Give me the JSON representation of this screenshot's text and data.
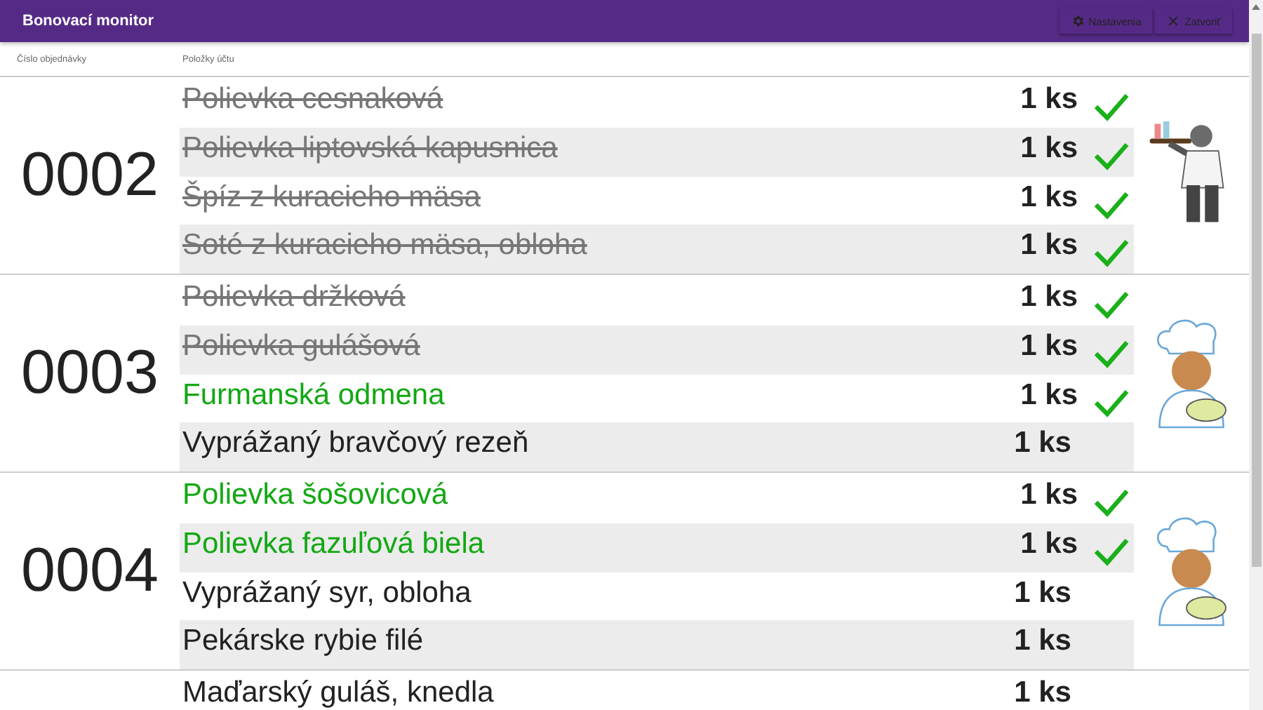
{
  "app_bar": {
    "title": "Bonovací monitor",
    "buttons": [
      {
        "kind": "settings",
        "label": "Nastavenia"
      },
      {
        "kind": "close",
        "label": "Zatvoriť"
      }
    ]
  },
  "table": {
    "columns": [
      "Číslo objednávky",
      "Položky účtu"
    ],
    "orders": [
      {
        "number": "0002",
        "illustration": {
          "kind": "waiter"
        },
        "items": [
          {
            "name": "Polievka cesnaková",
            "quantity": "1 ks",
            "served": true,
            "checked": true
          },
          {
            "name": "Polievka liptovská kapusnica",
            "quantity": "1 ks",
            "served": true,
            "checked": true
          },
          {
            "name": "Špíz z kuracieho mäsa",
            "quantity": "1 ks",
            "served": true,
            "checked": true
          },
          {
            "name": "Soté z kuracieho mäsa, obloha",
            "quantity": "1 ks",
            "served": true,
            "checked": true
          }
        ]
      },
      {
        "number": "0003",
        "illustration": {
          "kind": "chef"
        },
        "items": [
          {
            "name": "Polievka držková",
            "quantity": "1 ks",
            "served": true,
            "checked": true
          },
          {
            "name": "Polievka gulášová",
            "quantity": "1 ks",
            "served": true,
            "checked": true
          },
          {
            "name": "Furmanská odmena",
            "quantity": "1 ks",
            "served": false,
            "checked": true
          },
          {
            "name": "Vyprážaný bravčový rezeň",
            "quantity": "1 ks",
            "served": false,
            "checked": false
          }
        ]
      },
      {
        "number": "0004",
        "illustration": {
          "kind": "chef"
        },
        "items": [
          {
            "name": "Polievka šošovicová",
            "quantity": "1 ks",
            "served": false,
            "checked": true
          },
          {
            "name": "Polievka fazuľová biela",
            "quantity": "1 ks",
            "served": false,
            "checked": true
          },
          {
            "name": "Vyprážaný syr, obloha",
            "quantity": "1 ks",
            "served": false,
            "checked": false
          },
          {
            "name": "Pekárske rybie filé",
            "quantity": "1 ks",
            "served": false,
            "checked": false
          }
        ]
      },
      {
        "items": [
          {
            "name": "Maďarský guláš, knedla",
            "quantity": "1 ks",
            "served": false,
            "checked": false
          }
        ]
      }
    ]
  }
}
